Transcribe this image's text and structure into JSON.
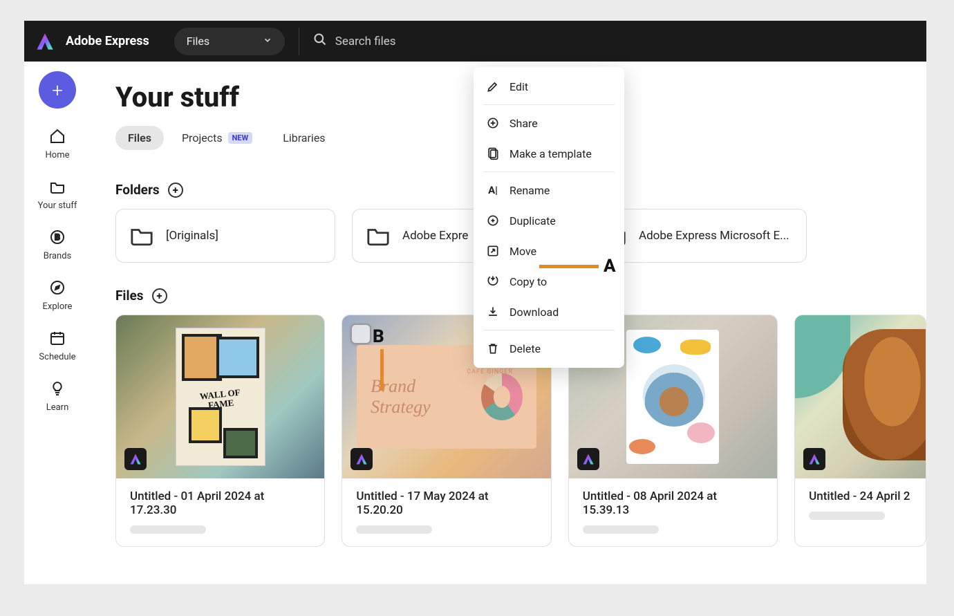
{
  "brand": "Adobe Express",
  "topbar": {
    "dropdown_label": "Files",
    "search_placeholder": "Search files"
  },
  "sidebar": {
    "items": [
      {
        "label": "Home",
        "icon": "home-icon"
      },
      {
        "label": "Your stuff",
        "icon": "folder-icon"
      },
      {
        "label": "Brands",
        "icon": "brand-icon"
      },
      {
        "label": "Explore",
        "icon": "compass-icon"
      },
      {
        "label": "Schedule",
        "icon": "calendar-icon"
      },
      {
        "label": "Learn",
        "icon": "lightbulb-icon"
      }
    ]
  },
  "page": {
    "title": "Your stuff",
    "tabs": [
      {
        "label": "Files",
        "active": true
      },
      {
        "label": "Projects",
        "badge": "NEW"
      },
      {
        "label": "Libraries"
      }
    ]
  },
  "folders_section": {
    "title": "Folders",
    "items": [
      {
        "name": "[Originals]"
      },
      {
        "name": "Adobe Expre"
      },
      {
        "name": "Adobe Express Microsoft E..."
      }
    ]
  },
  "files_section": {
    "title": "Files",
    "items": [
      {
        "title": "Untitled - 01 April 2024 at 17.23.30"
      },
      {
        "title": "Untitled - 17 May 2024 at 15.20.20",
        "selected_overlay": true
      },
      {
        "title": "Untitled - 08 April 2024 at 15.39.13"
      },
      {
        "title": "Untitled - 24 April 2"
      }
    ]
  },
  "context_menu": {
    "items": [
      {
        "label": "Edit",
        "icon": "pencil-icon"
      },
      {
        "label": "Share",
        "icon": "share-icon"
      },
      {
        "label": "Make a template",
        "icon": "template-icon"
      },
      {
        "label": "Rename",
        "icon": "rename-icon"
      },
      {
        "label": "Duplicate",
        "icon": "duplicate-icon"
      },
      {
        "label": "Move",
        "icon": "move-icon"
      },
      {
        "label": "Copy to",
        "icon": "copy-icon"
      },
      {
        "label": "Download",
        "icon": "download-icon"
      },
      {
        "label": "Delete",
        "icon": "trash-icon"
      }
    ]
  },
  "annotations": {
    "A": "A",
    "B": "B"
  },
  "thumb2": {
    "text": "Brand Strategy",
    "caption": "CAFE GINGER"
  },
  "thumb1": {
    "wof": "WALL OF FAME"
  }
}
